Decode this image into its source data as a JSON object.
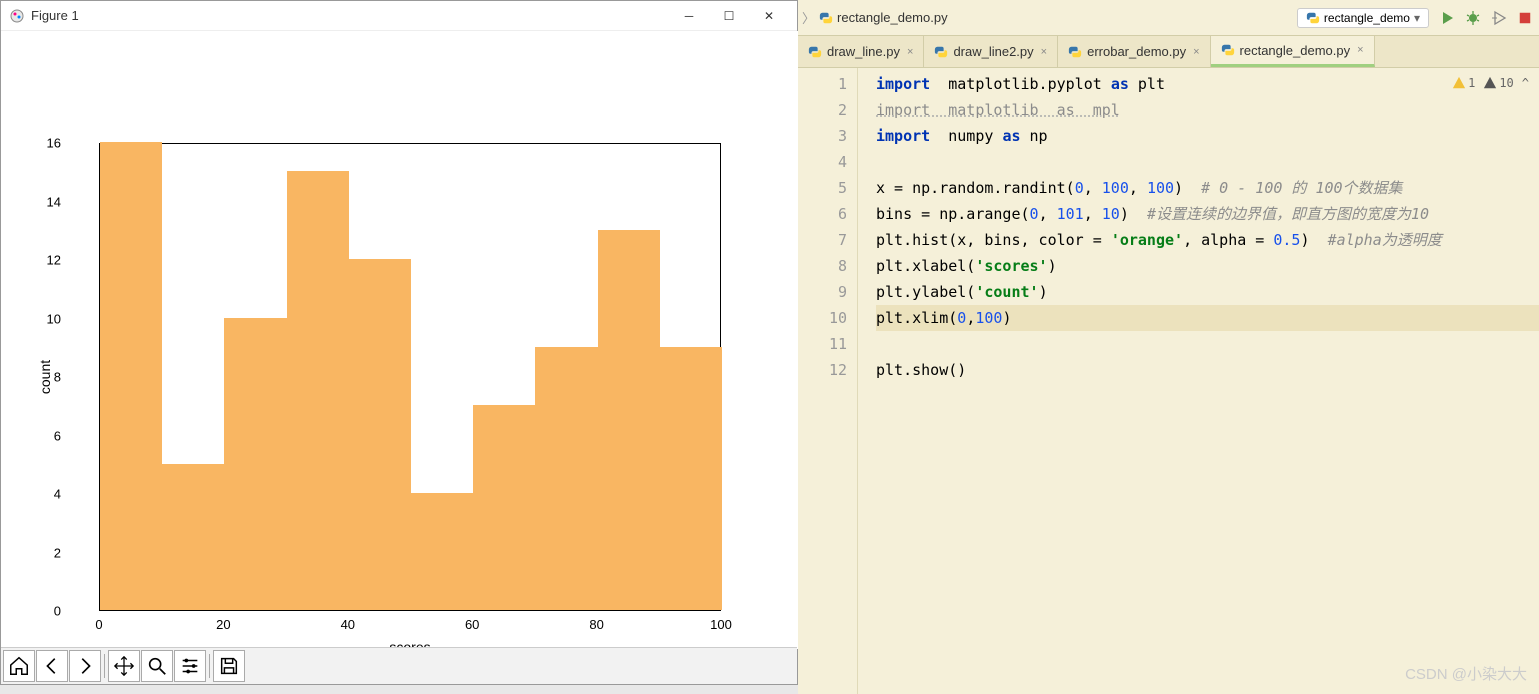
{
  "figure_window": {
    "title": "Figure 1",
    "toolbar": [
      "home",
      "back",
      "forward",
      "pan",
      "zoom",
      "configure",
      "save"
    ]
  },
  "chart_data": {
    "type": "bar",
    "categories": [
      0,
      10,
      20,
      30,
      40,
      50,
      60,
      70,
      80,
      90
    ],
    "values": [
      16,
      5,
      10,
      15,
      12,
      4,
      7,
      9,
      13,
      9
    ],
    "xlabel": "scores",
    "ylabel": "count",
    "xlim": [
      0,
      100
    ],
    "ylim": [
      0,
      16
    ],
    "xticks": [
      0,
      20,
      40,
      60,
      80,
      100
    ],
    "yticks": [
      0,
      2,
      4,
      6,
      8,
      10,
      12,
      14,
      16
    ],
    "color": "#f9b662"
  },
  "ide": {
    "breadcrumb_file": "rectangle_demo.py",
    "run_config": "rectangle_demo",
    "tabs": [
      {
        "label": "draw_line.py",
        "active": false
      },
      {
        "label": "draw_line2.py",
        "active": false
      },
      {
        "label": "errobar_demo.py",
        "active": false
      },
      {
        "label": "rectangle_demo.py",
        "active": true
      }
    ],
    "inspections": {
      "warn_yellow": "1",
      "warn_dark": "10"
    },
    "line_numbers": [
      1,
      2,
      3,
      4,
      5,
      6,
      7,
      8,
      9,
      10,
      11,
      12
    ],
    "code": {
      "l1": {
        "a": "import  ",
        "b": "matplotlib.pyplot ",
        "c": "as ",
        "d": "plt"
      },
      "l2": {
        "a": "import  matplotlib  as  mpl"
      },
      "l3": {
        "a": "import  ",
        "b": "numpy ",
        "c": "as ",
        "d": "np"
      },
      "l4": "",
      "l5": {
        "a": "x = np.random.randint(",
        "n1": "0",
        "c1": ", ",
        "n2": "100",
        "c2": ", ",
        "n3": "100",
        "r": ")  ",
        "cmt": "# 0 - 100 的 100个数据集"
      },
      "l6": {
        "a": "bins = np.arange(",
        "n1": "0",
        "c1": ", ",
        "n2": "101",
        "c2": ", ",
        "n3": "10",
        "r": ")  ",
        "cmt": "#设置连续的边界值，即直方图的宽度为10"
      },
      "l7": {
        "a": "plt.hist(x, bins, color = ",
        "s": "'orange'",
        "b": ", alpha = ",
        "n": "0.5",
        "r": ")  ",
        "cmt": "#alpha为透明度"
      },
      "l8": {
        "a": "plt.xlabel(",
        "s": "'scores'",
        "r": ")"
      },
      "l9": {
        "a": "plt.ylabel(",
        "s": "'count'",
        "r": ")"
      },
      "l10": {
        "a": "plt.xlim(",
        "n1": "0",
        "c": ",",
        "n2": "100",
        "r": ")"
      },
      "l11": "",
      "l12": {
        "a": "plt.show()"
      }
    }
  },
  "watermark": "CSDN @小染大大"
}
